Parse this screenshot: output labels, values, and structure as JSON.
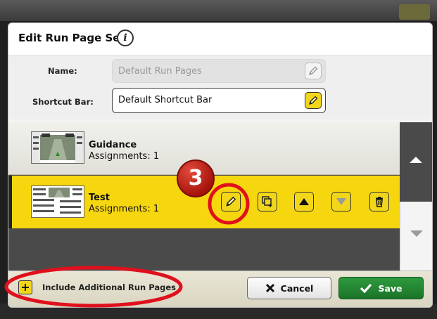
{
  "dialog": {
    "title": "Edit Run Page Set",
    "info_icon": "i"
  },
  "form": {
    "name_label": "Name:",
    "name_value": "Default Run Pages",
    "shortcut_label": "Shortcut Bar:",
    "shortcut_value": "Default Shortcut Bar"
  },
  "list": {
    "items": [
      {
        "name": "Guidance",
        "assignments": "Assignments: 1",
        "selected": false
      },
      {
        "name": "Test",
        "assignments": "Assignments: 1",
        "selected": true
      }
    ]
  },
  "row_actions": [
    "pencil-icon",
    "copy-add-icon",
    "arrow-up-icon",
    "arrow-down-icon",
    "trash-icon"
  ],
  "footer": {
    "include_plus": "+",
    "include_label": "Include Additional Run Pages",
    "cancel_label": "Cancel",
    "save_label": "Save"
  },
  "annotation": {
    "step_number": "3"
  },
  "colors": {
    "accent_yellow": "#f2d61a",
    "save_green": "#1f7f2e",
    "annotation_red": "#e0101c"
  }
}
